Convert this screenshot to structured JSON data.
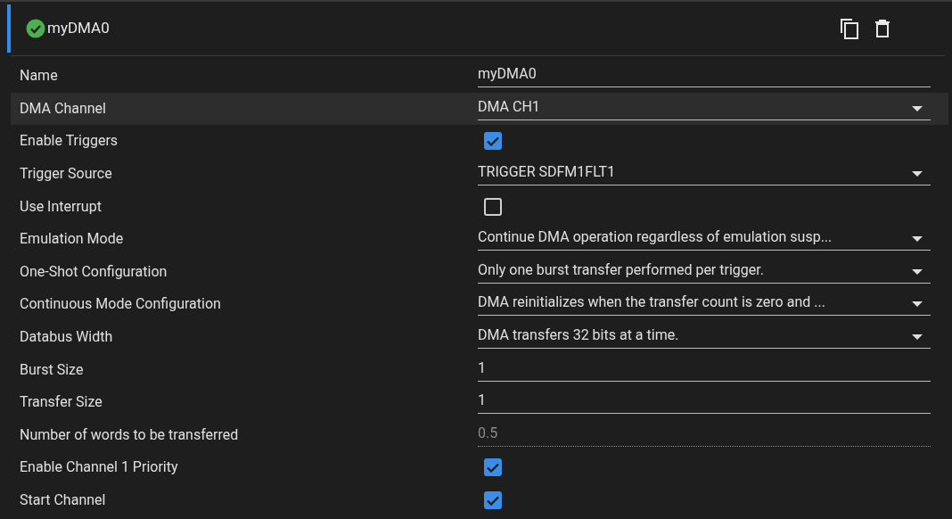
{
  "header": {
    "title": "myDMA0",
    "valid": true
  },
  "rows": [
    {
      "label": "Name",
      "kind": "text",
      "value": "myDMA0",
      "selected": false
    },
    {
      "label": "DMA Channel",
      "kind": "select",
      "value": "DMA CH1",
      "selected": true
    },
    {
      "label": "Enable Triggers",
      "kind": "checkbox",
      "checked": true,
      "selected": false
    },
    {
      "label": "Trigger Source",
      "kind": "select",
      "value": "TRIGGER SDFM1FLT1",
      "selected": false
    },
    {
      "label": "Use Interrupt",
      "kind": "checkbox",
      "checked": false,
      "selected": false
    },
    {
      "label": "Emulation Mode",
      "kind": "select",
      "value": "Continue DMA operation regardless of emulation susp...",
      "selected": false
    },
    {
      "label": "One-Shot Configuration",
      "kind": "select",
      "value": "Only one burst transfer performed per trigger.",
      "selected": false
    },
    {
      "label": "Continuous Mode Configuration",
      "kind": "select",
      "value": "DMA reinitializes when the transfer count is zero and ...",
      "selected": false
    },
    {
      "label": "Databus Width",
      "kind": "select",
      "value": "DMA transfers 32 bits at a time.",
      "selected": false
    },
    {
      "label": "Burst Size",
      "kind": "text",
      "value": "1",
      "selected": false
    },
    {
      "label": "Transfer Size",
      "kind": "text",
      "value": "1",
      "selected": false
    },
    {
      "label": "Number of words to be transferred",
      "kind": "readonly",
      "value": "0.5",
      "selected": false
    },
    {
      "label": "Enable Channel 1 Priority",
      "kind": "checkbox",
      "checked": true,
      "selected": false
    },
    {
      "label": "Start Channel",
      "kind": "checkbox",
      "checked": true,
      "selected": false
    }
  ]
}
